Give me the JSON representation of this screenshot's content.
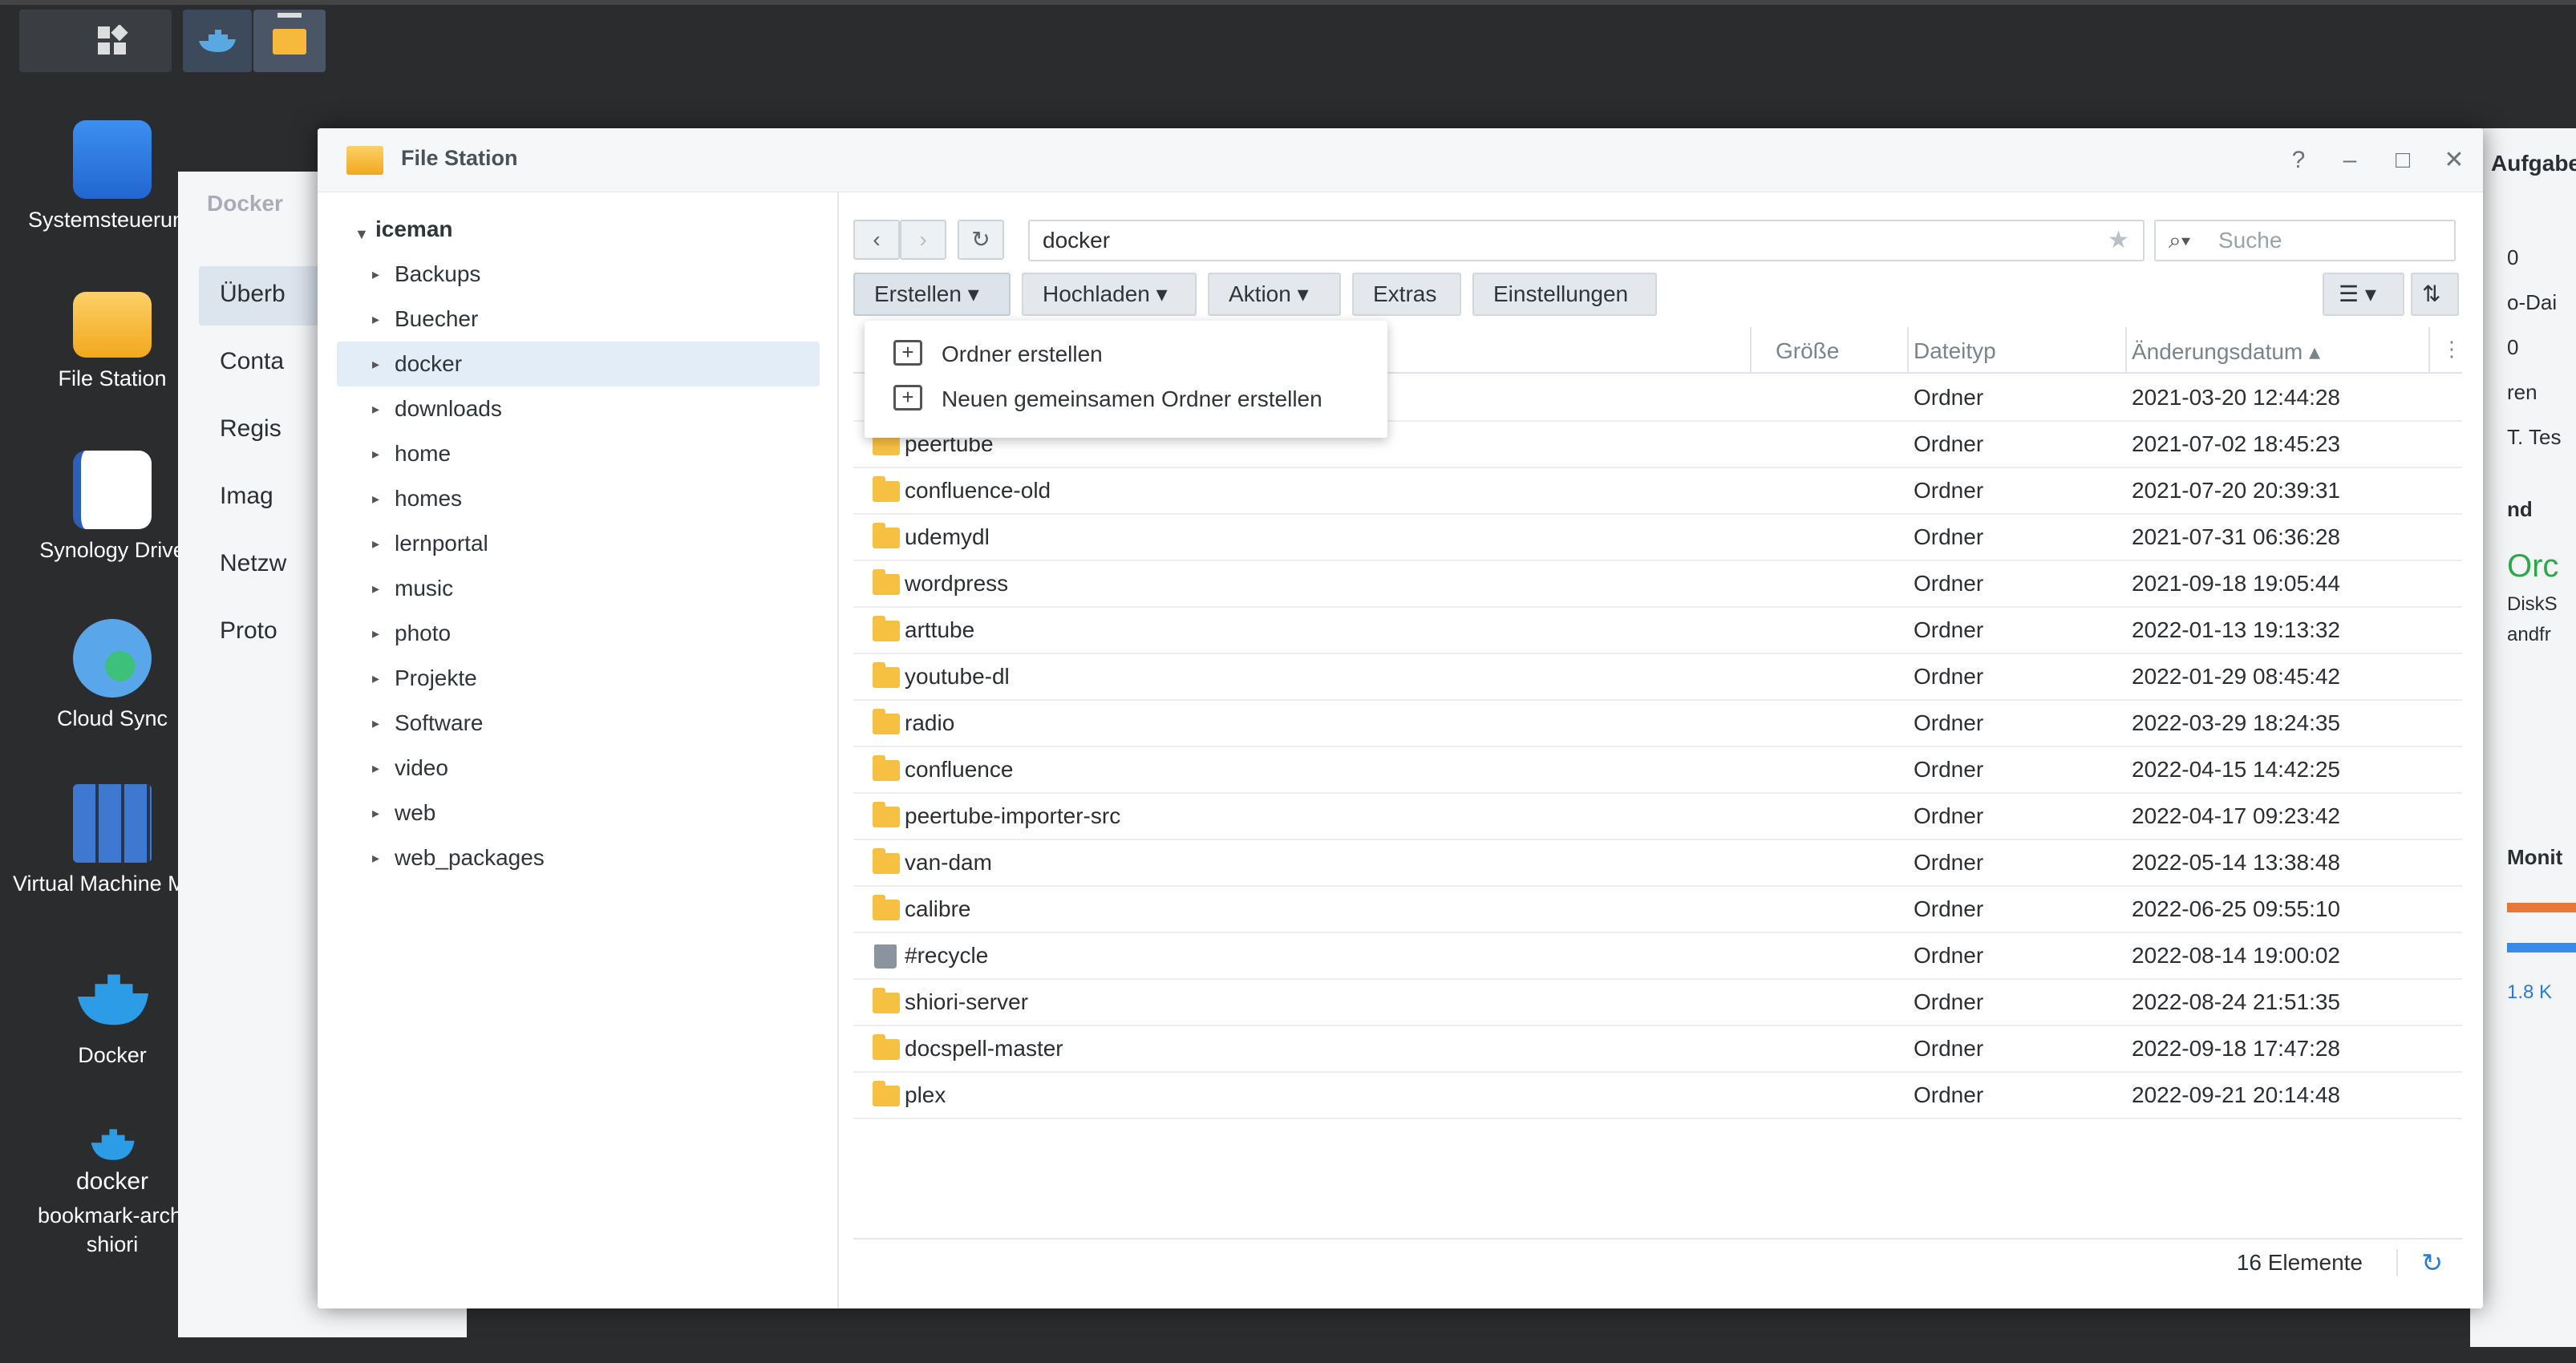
{
  "desktop": {
    "icons": [
      {
        "label": "Systemsteuerung",
        "icon": "control-panel-icon"
      },
      {
        "label": "File Station",
        "icon": "folder-icon"
      },
      {
        "label": "Synology Drive",
        "icon": "drive-icon"
      },
      {
        "label": "Cloud Sync",
        "icon": "cloud-sync-icon"
      },
      {
        "label": "Virtual Machine Manager",
        "icon": "vm-icon"
      },
      {
        "label": "Docker",
        "icon": "docker-icon"
      },
      {
        "label": "bookmark-archi shiori",
        "icon": "docker-container-icon",
        "badge": "docker"
      }
    ]
  },
  "background_window": {
    "title": "Docker",
    "items": [
      "Überb",
      "Conta",
      "Regis",
      "Imag",
      "Netzw",
      "Proto"
    ]
  },
  "right_window": {
    "title": "Aufgabe",
    "texts": [
      "0",
      "o-Dai",
      "0",
      "ren",
      "T. Tes",
      "nd",
      "Orc",
      "DiskS",
      "andfr",
      "Monit",
      "1.8 K"
    ]
  },
  "window": {
    "title": "File Station",
    "help": "?",
    "tree": {
      "root": "iceman",
      "items": [
        "Backups",
        "Buecher",
        "docker",
        "downloads",
        "home",
        "homes",
        "lernportal",
        "music",
        "photo",
        "Projekte",
        "Software",
        "video",
        "web",
        "web_packages"
      ],
      "selected": "docker"
    },
    "path": "docker",
    "search_placeholder": "Suche",
    "toolbar": {
      "create": "Erstellen",
      "upload": "Hochladen",
      "action": "Aktion",
      "extras": "Extras",
      "settings": "Einstellungen"
    },
    "menu": {
      "create_folder": "Ordner erstellen",
      "create_shared": "Neuen gemeinsamen Ordner erstellen"
    },
    "columns": {
      "size": "Größe",
      "type": "Dateityp",
      "modified": "Änderungsdatum"
    },
    "rows": [
      {
        "name": "",
        "type": "Ordner",
        "date": "2021-03-20 12:44:28"
      },
      {
        "name": "peertube",
        "type": "Ordner",
        "date": "2021-07-02 18:45:23"
      },
      {
        "name": "confluence-old",
        "type": "Ordner",
        "date": "2021-07-20 20:39:31"
      },
      {
        "name": "udemydl",
        "type": "Ordner",
        "date": "2021-07-31 06:36:28"
      },
      {
        "name": "wordpress",
        "type": "Ordner",
        "date": "2021-09-18 19:05:44"
      },
      {
        "name": "arttube",
        "type": "Ordner",
        "date": "2022-01-13 19:13:32"
      },
      {
        "name": "youtube-dl",
        "type": "Ordner",
        "date": "2022-01-29 08:45:42"
      },
      {
        "name": "radio",
        "type": "Ordner",
        "date": "2022-03-29 18:24:35"
      },
      {
        "name": "confluence",
        "type": "Ordner",
        "date": "2022-04-15 14:42:25"
      },
      {
        "name": "peertube-importer-src",
        "type": "Ordner",
        "date": "2022-04-17 09:23:42"
      },
      {
        "name": "van-dam",
        "type": "Ordner",
        "date": "2022-05-14 13:38:48"
      },
      {
        "name": "calibre",
        "type": "Ordner",
        "date": "2022-06-25 09:55:10"
      },
      {
        "name": "#recycle",
        "type": "Ordner",
        "date": "2022-08-14 19:00:02",
        "icon": "trash-icon"
      },
      {
        "name": "shiori-server",
        "type": "Ordner",
        "date": "2022-08-24 21:51:35"
      },
      {
        "name": "docspell-master",
        "type": "Ordner",
        "date": "2022-09-18 17:47:28"
      },
      {
        "name": "plex",
        "type": "Ordner",
        "date": "2022-09-21 20:14:48"
      }
    ],
    "status": "16 Elemente"
  }
}
